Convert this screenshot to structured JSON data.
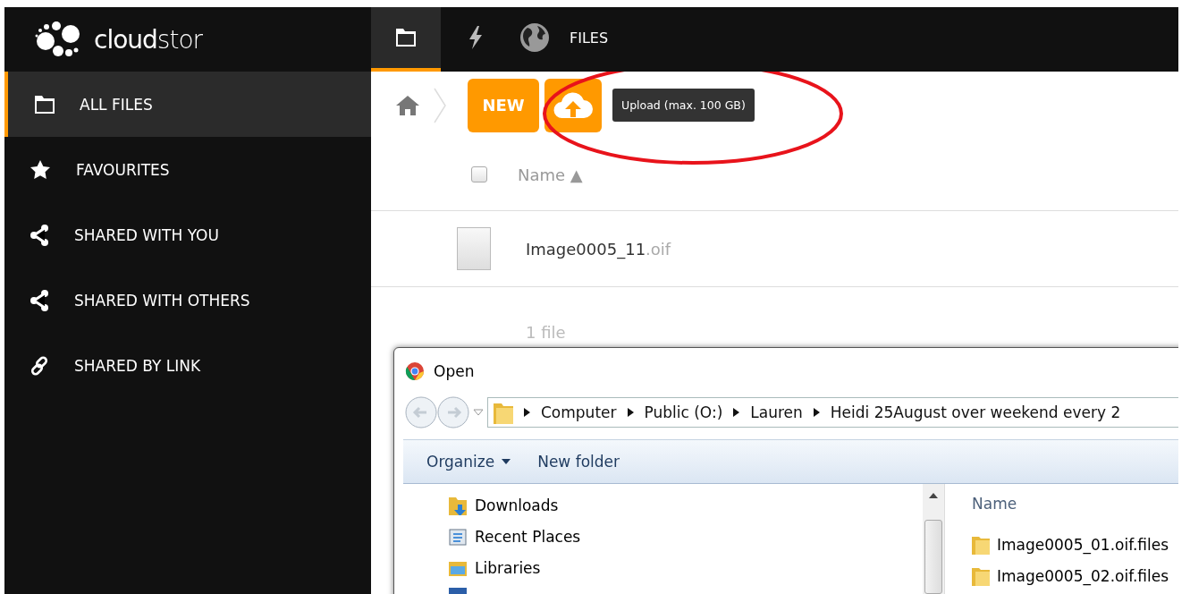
{
  "brand": {
    "logo_text": "**cloud**stor"
  },
  "top_nav": [
    {
      "selected": true
    },
    {
      "selected": false
    },
    {
      "label": "FILES",
      "selected": false
    }
  ],
  "sidebar": {
    "items": [
      {
        "label": "ALL FILES",
        "selected": true
      },
      {
        "label": "FAVOURITES",
        "selected": false
      },
      {
        "label": "SHARED WITH YOU",
        "selected": false
      },
      {
        "label": "SHARED WITH OTHERS",
        "selected": false
      },
      {
        "label": "SHARED BY LINK",
        "selected": false
      }
    ]
  },
  "toolbar": {
    "new_button": "NEW",
    "upload_tooltip": "Upload (max. 100 GB)"
  },
  "file_list": {
    "select_all_checked": false,
    "columns": [
      {
        "label": "Name",
        "sort": "▲"
      }
    ],
    "rows": [
      {
        "name": "Image0005_11",
        "extension": ".oif"
      }
    ],
    "summary": "1 file"
  },
  "open_dialog": {
    "title": "Open",
    "path": [
      "Computer",
      "Public (O:)",
      "Lauren",
      "Heidi 25August over weekend every 2"
    ],
    "commands": [
      {
        "label": "Organize",
        "dropdown": true
      },
      {
        "label": "New folder",
        "dropdown": false
      }
    ],
    "nav_items": [
      {
        "label": "Downloads"
      },
      {
        "label": "Recent Places"
      },
      {
        "label": "Libraries"
      }
    ],
    "files_column": "Name",
    "files": [
      {
        "name": "Image0005_01.oif.files"
      },
      {
        "name": "Image0005_02.oif.files"
      }
    ]
  }
}
